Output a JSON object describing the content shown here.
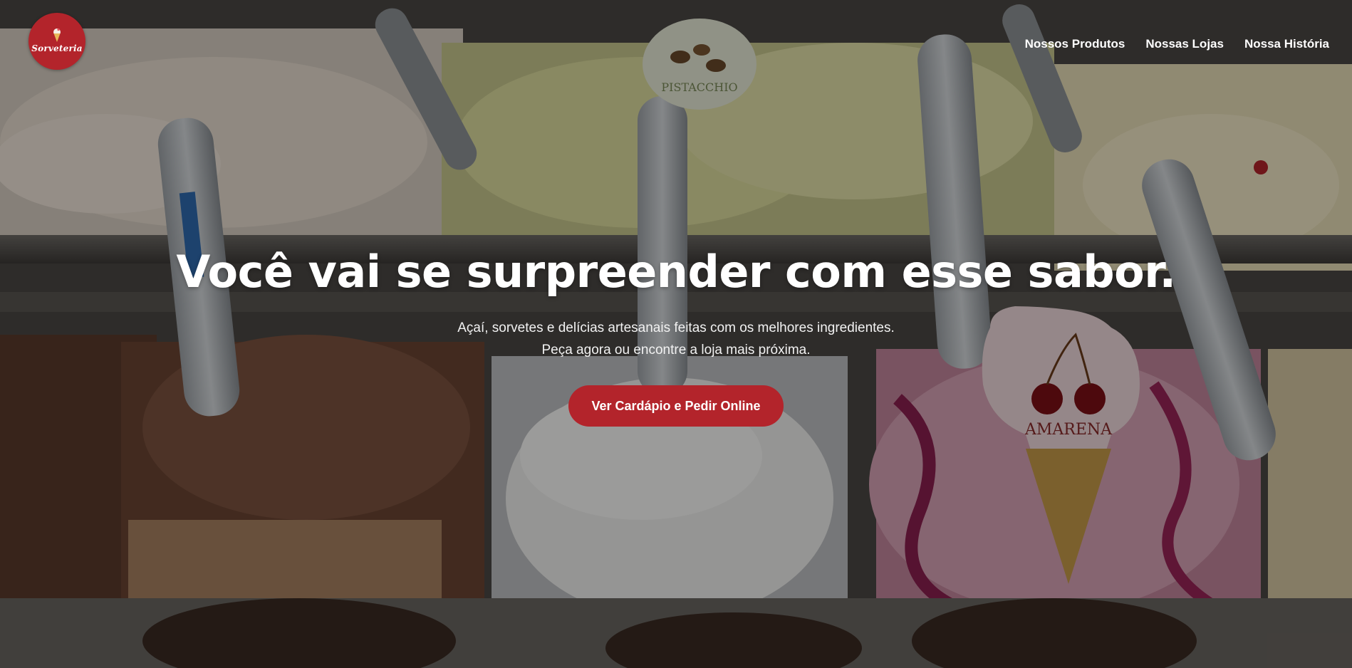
{
  "brand": {
    "logo_text": "Sorveteria",
    "logo_color": "#b3242b"
  },
  "nav": {
    "items": [
      {
        "label": "Nossos Produtos"
      },
      {
        "label": "Nossas Lojas"
      },
      {
        "label": "Nossa História"
      }
    ]
  },
  "hero": {
    "headline": "Você vai se surpreender com esse sabor.",
    "subtitle": "Açaí, sorvetes e delícias artesanais feitas com os melhores ingredientes. Peça agora ou encontre a loja mais próxima.",
    "cta_label": "Ver Cardápio e Pedir Online",
    "cta_color": "#b3242b",
    "background_description_icon": "ice-cream-display-photo",
    "flavor_tags": [
      {
        "label": "PISTACCHIO"
      },
      {
        "label": "AMARENA"
      }
    ]
  }
}
